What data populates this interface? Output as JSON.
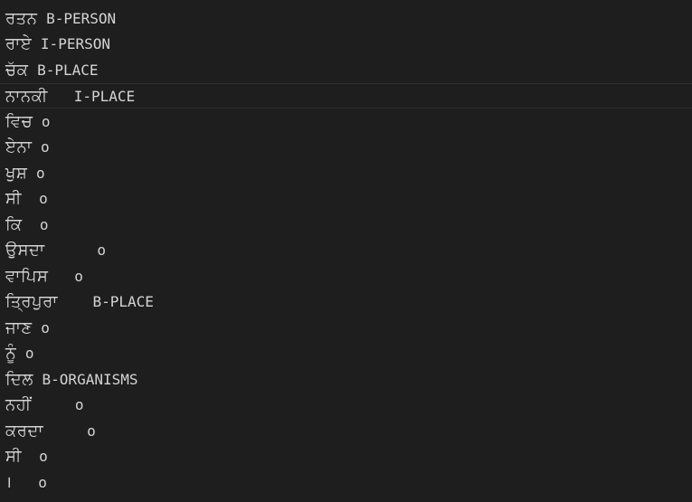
{
  "editor": {
    "lines": [
      {
        "token": "ਰਤਨ",
        "sep": " ",
        "tag": "B-PERSON"
      },
      {
        "token": "ਰਾਏ",
        "sep": " ",
        "tag": "I-PERSON"
      },
      {
        "token": "ਚੱਕ",
        "sep": " ",
        "tag": "B-PLACE"
      },
      {
        "token": "ਨਾਨਕੀ",
        "sep": "   ",
        "tag": "I-PLACE"
      },
      {
        "token": "ਵਿਚ",
        "sep": " ",
        "tag": "o"
      },
      {
        "token": "ਏਨਾ",
        "sep": " ",
        "tag": "o"
      },
      {
        "token": "ਖੁਸ਼",
        "sep": " ",
        "tag": "o"
      },
      {
        "token": "ਸੀ",
        "sep": "  ",
        "tag": "o"
      },
      {
        "token": "ਕਿ",
        "sep": "  ",
        "tag": "o"
      },
      {
        "token": "ਉਸਦਾ",
        "sep": "      ",
        "tag": "o"
      },
      {
        "token": "ਵਾਪਿਸ",
        "sep": "   ",
        "tag": "o"
      },
      {
        "token": "ਤ੍ਰਿਪੁਰਾ",
        "sep": "    ",
        "tag": "B-PLACE"
      },
      {
        "token": "ਜਾਣ",
        "sep": " ",
        "tag": "o"
      },
      {
        "token": "ਨੂੰ",
        "sep": " ",
        "tag": "o"
      },
      {
        "token": "ਦਿਲ",
        "sep": " ",
        "tag": "B-ORGANISMS"
      },
      {
        "token": "ਨਹੀਂ",
        "sep": "     ",
        "tag": "o"
      },
      {
        "token": "ਕਰਦਾ",
        "sep": "     ",
        "tag": "o"
      },
      {
        "token": "ਸੀ",
        "sep": "  ",
        "tag": "o"
      },
      {
        "token": "।",
        "sep": "   ",
        "tag": "o"
      }
    ]
  },
  "colors": {
    "background": "#1e1e1e",
    "text": "#d4d4d4",
    "current_line_border": "#2f2f2f"
  }
}
